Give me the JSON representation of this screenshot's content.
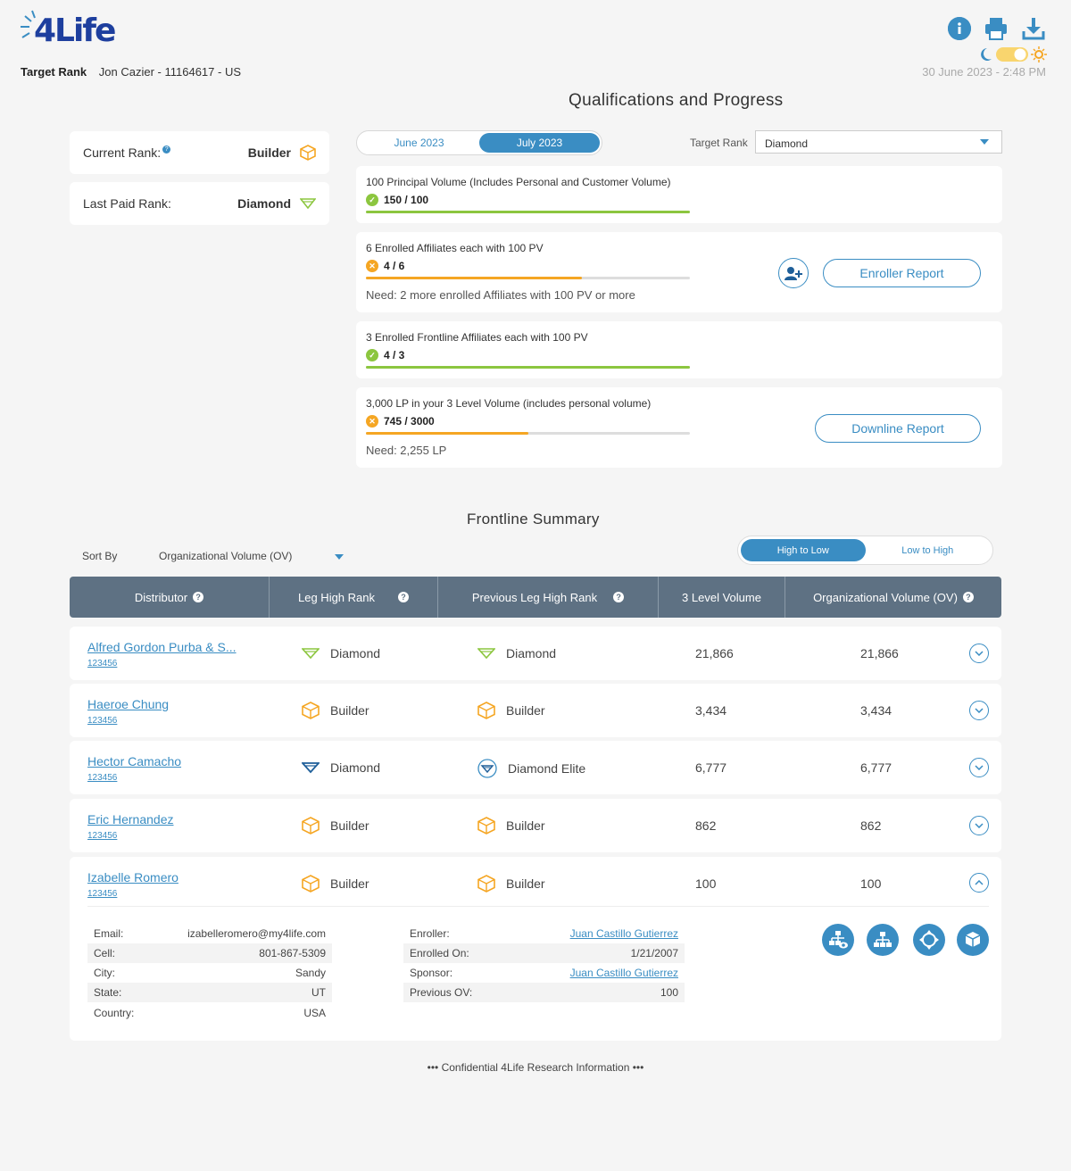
{
  "brand": {
    "logo_text": "4Life"
  },
  "header": {
    "target_rank_label": "Target Rank",
    "member": "Jon Cazier - 11164617 - US",
    "date": "30  June 2023 - 2:48 PM"
  },
  "qualifications": {
    "title": "Qualifications and Progress",
    "current_rank_label": "Current Rank:",
    "current_rank_value": "Builder",
    "last_paid_label": "Last Paid Rank:",
    "last_paid_value": "Diamond",
    "months": [
      "June 2023",
      "July 2023"
    ],
    "active_month": "July 2023",
    "target_rank_label": "Target Rank",
    "target_rank_value": "Diamond",
    "items": [
      {
        "title": "100 Principal Volume (Includes Personal and Customer Volume)",
        "value": "150 / 100",
        "status": "met",
        "progress": 1.0,
        "need": ""
      },
      {
        "title": "6 Enrolled Affiliates each with 100 PV",
        "value": "4 / 6",
        "status": "unmet",
        "progress": 0.6667,
        "need": "Need: 2 more enrolled Affiliates with 100 PV or more"
      },
      {
        "title": "3 Enrolled Frontline Affiliates each with 100 PV",
        "value": "4 / 3",
        "status": "met",
        "progress": 1.0,
        "need": ""
      },
      {
        "title": "3,000 LP in your 3 Level Volume (includes personal volume)",
        "value": "745 / 3000",
        "status": "unmet",
        "progress": 0.5,
        "need": "Need: 2,255 LP"
      }
    ],
    "enroller_report": "Enroller Report",
    "downline_report": "Downline Report"
  },
  "frontline": {
    "title": "Frontline Summary",
    "sort_label": "Sort By",
    "sort_value": "Organizational Volume (OV)",
    "order_options": [
      "High to Low",
      "Low to High"
    ],
    "active_order": "High to Low",
    "columns": [
      "Distributor",
      "Leg High Rank",
      "Previous Leg High Rank",
      "3 Level Volume",
      "Organizational Volume (OV)"
    ],
    "rows": [
      {
        "name": "Alfred Gordon Purba & S...",
        "id": "123456",
        "leg_rank": "Diamond",
        "leg_icon": "diamond-green-icon",
        "prev_rank": "Diamond",
        "prev_icon": "diamond-green-icon",
        "lv3": "21,866",
        "ov": "21,866"
      },
      {
        "name": "Haeroe Chung",
        "id": "123456",
        "leg_rank": "Builder",
        "leg_icon": "builder-cube-icon",
        "prev_rank": "Builder",
        "prev_icon": "builder-cube-icon",
        "lv3": "3,434",
        "ov": "3,434"
      },
      {
        "name": "Hector Camacho",
        "id": "123456",
        "leg_rank": "Diamond",
        "leg_icon": "diamond-blue-icon",
        "prev_rank": "Diamond Elite",
        "prev_icon": "diamond-elite-icon",
        "lv3": "6,777",
        "ov": "6,777"
      },
      {
        "name": "Eric Hernandez",
        "id": "123456",
        "leg_rank": "Builder",
        "leg_icon": "builder-cube-icon",
        "prev_rank": "Builder",
        "prev_icon": "builder-cube-icon",
        "lv3": "862",
        "ov": "862"
      },
      {
        "name": "Izabelle Romero",
        "id": "123456",
        "leg_rank": "Builder",
        "leg_icon": "builder-cube-icon",
        "prev_rank": "Builder",
        "prev_icon": "builder-cube-icon",
        "lv3": "100",
        "ov": "100"
      }
    ],
    "details": {
      "left": [
        {
          "k": "Email:",
          "v": "izabelleromero@my4life.com"
        },
        {
          "k": "Cell:",
          "v": "801-867-5309"
        },
        {
          "k": "City:",
          "v": "Sandy"
        },
        {
          "k": "State:",
          "v": "UT"
        },
        {
          "k": "Country:",
          "v": "USA"
        }
      ],
      "right": [
        {
          "k": "Enroller:",
          "v": "Juan Castillo Gutierrez",
          "link": true
        },
        {
          "k": "Enrolled On:",
          "v": "1/21/2007"
        },
        {
          "k": "Sponsor:",
          "v": "Juan Castillo Gutierrez",
          "link": true
        },
        {
          "k": "Previous OV:",
          "v": "100"
        }
      ]
    }
  },
  "footer": "••• Confidential 4Life Research Information •••",
  "colors": {
    "accent": "#3a8dc3",
    "met": "#8cc63f",
    "unmet": "#f5a623",
    "header": "#5e7183",
    "builder": "#f5a623"
  }
}
